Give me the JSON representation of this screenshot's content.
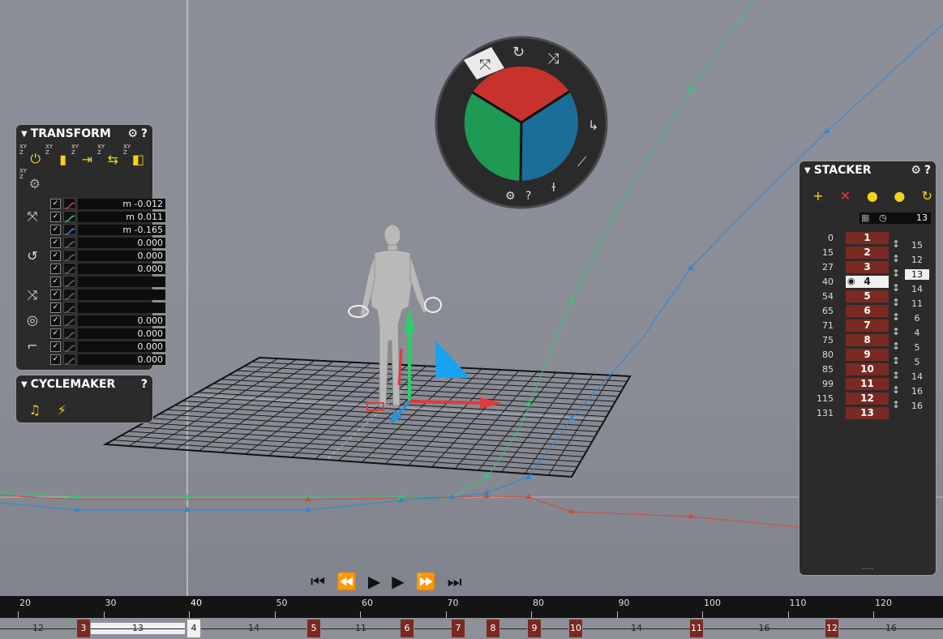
{
  "transform": {
    "title": "TRANSFORM",
    "settings_icon": "gear-icon",
    "help_icon": "question-icon",
    "tools": [
      {
        "name": "power",
        "glyph": "⏻"
      },
      {
        "name": "copy",
        "glyph": "▮"
      },
      {
        "name": "paste",
        "glyph": "⇥"
      },
      {
        "name": "paste-mirror",
        "glyph": "⇆"
      },
      {
        "name": "mirror",
        "glyph": "◧"
      },
      {
        "name": "settings",
        "glyph": "⚙"
      }
    ],
    "channels": [
      {
        "group": "translate",
        "value": "m -0.012",
        "color": "#e03b3b"
      },
      {
        "group": "translate",
        "value": "m 0.011",
        "color": "#2fcb6a"
      },
      {
        "group": "translate",
        "value": "m -0.165",
        "color": "#2f8ed8"
      },
      {
        "group": "rotate",
        "value": "0.000",
        "color": "#666"
      },
      {
        "group": "rotate",
        "value": "0.000",
        "color": "#666"
      },
      {
        "group": "rotate",
        "value": "0.000",
        "color": "#666"
      },
      {
        "group": "scale",
        "value": "",
        "color": "#666"
      },
      {
        "group": "scale",
        "value": "",
        "color": "#666"
      },
      {
        "group": "scale",
        "value": "",
        "color": "#666"
      },
      {
        "group": "roll",
        "value": "0.000",
        "color": "#666"
      },
      {
        "group": "foot",
        "value": "0.000",
        "color": "#666"
      },
      {
        "group": "foot",
        "value": "0.000",
        "color": "#666"
      },
      {
        "group": "foot",
        "value": "0.000",
        "color": "#666"
      }
    ]
  },
  "cyclemaker": {
    "title": "CYCLEMAKER",
    "help_icon": "question-icon"
  },
  "stacker": {
    "title": "STACKER",
    "frame_count": "13",
    "keys": [
      {
        "frame": "0",
        "label": "1",
        "length": "15"
      },
      {
        "frame": "15",
        "label": "2",
        "length": "12"
      },
      {
        "frame": "27",
        "label": "3",
        "length": "13",
        "selected": true
      },
      {
        "frame": "40",
        "label": "4",
        "length": "14",
        "current": true
      },
      {
        "frame": "54",
        "label": "5",
        "length": "11"
      },
      {
        "frame": "65",
        "label": "6",
        "length": "6"
      },
      {
        "frame": "71",
        "label": "7",
        "length": "4"
      },
      {
        "frame": "75",
        "label": "8",
        "length": "5"
      },
      {
        "frame": "80",
        "label": "9",
        "length": "5"
      },
      {
        "frame": "85",
        "label": "10",
        "length": "14"
      },
      {
        "frame": "99",
        "label": "11",
        "length": "16"
      },
      {
        "frame": "115",
        "label": "12",
        "length": "16"
      },
      {
        "frame": "131",
        "label": "13",
        "length": ""
      }
    ],
    "footer": "....."
  },
  "gizmo": {
    "mode_icons": [
      "translate-icon",
      "rotate-icon",
      "scale-icon"
    ],
    "colors": {
      "red": "#c8322c",
      "green": "#1f9a55",
      "blue": "#1b6e9a"
    }
  },
  "timeline": {
    "ruler_labels": [
      "20",
      "30",
      "40",
      "50",
      "60",
      "70",
      "80",
      "90",
      "100",
      "110",
      "120"
    ],
    "current_frame": "40",
    "segments": [
      {
        "label": "12",
        "type": "seg"
      },
      {
        "label": "3",
        "type": "key"
      },
      {
        "label": "13",
        "type": "seg",
        "selected": true
      },
      {
        "label": "4",
        "type": "key",
        "selected": true
      },
      {
        "label": "14",
        "type": "seg"
      },
      {
        "label": "5",
        "type": "key"
      },
      {
        "label": "11",
        "type": "seg"
      },
      {
        "label": "6",
        "type": "key"
      },
      {
        "label": "",
        "type": "seg"
      },
      {
        "label": "7",
        "type": "key"
      },
      {
        "label": "8",
        "type": "key"
      },
      {
        "label": "",
        "type": "seg"
      },
      {
        "label": "9",
        "type": "key"
      },
      {
        "label": "",
        "type": "seg"
      },
      {
        "label": "10",
        "type": "key"
      },
      {
        "label": "14",
        "type": "seg"
      },
      {
        "label": "11",
        "type": "key"
      },
      {
        "label": "16",
        "type": "seg"
      },
      {
        "label": "12",
        "type": "key"
      },
      {
        "label": "16",
        "type": "seg"
      }
    ]
  },
  "transport": [
    "jump-start-icon",
    "prev-key-icon",
    "play-icon",
    "play-zoom-icon",
    "next-key-icon",
    "jump-end-icon"
  ]
}
